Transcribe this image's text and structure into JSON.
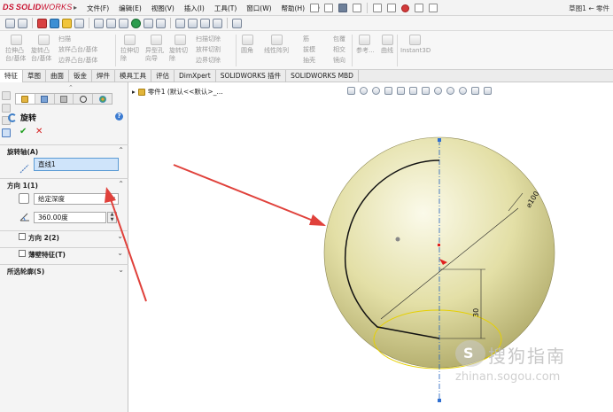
{
  "app": {
    "logo_prefix": "DS",
    "logo_main": "SOLID",
    "logo_suffix": "WORKS",
    "window_title": "草图1 ← 零件"
  },
  "menus": [
    "文件(F)",
    "编辑(E)",
    "视图(V)",
    "插入(I)",
    "工具(T)",
    "窗口(W)",
    "帮助(H)"
  ],
  "command_manager": {
    "groups": [
      {
        "lines": [
          "拉伸凸",
          "台/基体"
        ]
      },
      {
        "lines": [
          "旋转凸",
          "台/基体"
        ]
      },
      {
        "lines": [
          "扫描",
          "放样凸台/基体",
          "边界凸台/基体"
        ]
      },
      {
        "lines": [
          "拉伸切",
          "除"
        ]
      },
      {
        "lines": [
          "异型孔",
          "向导"
        ]
      },
      {
        "lines": [
          "旋转切",
          "除"
        ]
      },
      {
        "lines": [
          "扫描切除",
          "放样切割",
          "边界切除"
        ]
      },
      {
        "lines": [
          "圆角"
        ]
      },
      {
        "lines": [
          "线性阵列"
        ]
      },
      {
        "lines": [
          "筋",
          "拔模",
          "抽壳"
        ]
      },
      {
        "lines": [
          "包覆",
          "相交",
          "镜向"
        ]
      },
      {
        "lines": [
          "参考..."
        ]
      },
      {
        "lines": [
          "曲线"
        ]
      },
      {
        "lines": [
          "Instant3D"
        ]
      }
    ]
  },
  "tabs": [
    "特征",
    "草图",
    "曲面",
    "钣金",
    "焊件",
    "模具工具",
    "评估",
    "DimXpert",
    "SOLIDWORKS 插件",
    "SOLIDWORKS MBD"
  ],
  "active_tab_index": 0,
  "property_manager": {
    "title": "旋转",
    "help": "?",
    "ok": "✔",
    "cancel": "✕",
    "axis_group": {
      "label": "旋转轴(A)",
      "value": "直线1"
    },
    "direction1": {
      "label": "方向 1(1)",
      "end_condition": "给定深度",
      "angle": "360.00度"
    },
    "direction2": {
      "label": "方向 2(2)",
      "checked": false
    },
    "thin_feature": {
      "label": "薄壁特征(T)",
      "checked": false
    },
    "selected_contours": {
      "label": "所选轮廓(S)"
    }
  },
  "feature_tree": {
    "crumb": "零件1 (默认<<默认>_..."
  },
  "viewport": {
    "sphere_color": "#e3dfa6",
    "sketch_color": "#111111",
    "dimension_diameter": "⌀100",
    "dimension_height": "30",
    "arrow_color": "#e0413b",
    "ellipse_color": "#e6d000"
  },
  "watermark": {
    "cn": "搜狗指南",
    "url": "zhinan.sogou.com"
  }
}
